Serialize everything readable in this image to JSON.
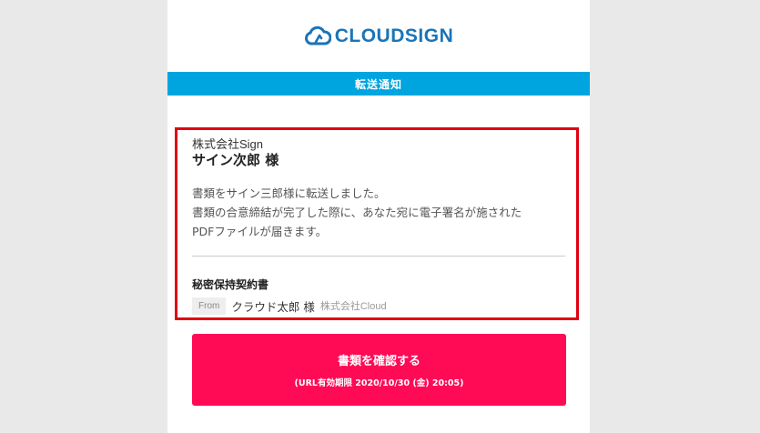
{
  "brand": {
    "logo_part1": "CLOUD",
    "logo_part2": "SIGN",
    "icon": "cloud-sign-icon",
    "color": "#1b74b8"
  },
  "banner": {
    "text": "転送通知",
    "color": "#00a5e0"
  },
  "recipient": {
    "company": "株式会社Sign",
    "name": "サイン次郎 様"
  },
  "message": {
    "line1": "書類をサイン三郎様に転送しました。",
    "line2": "書類の合意締結が完了した際に、あなた宛に電子署名が施された",
    "line3": "PDFファイルが届きます。"
  },
  "document": {
    "title": "秘密保持契約書",
    "from_label": "From",
    "sender_name": "クラウド太郎 様",
    "sender_company": "株式会社Cloud"
  },
  "cta": {
    "label": "書類を確認する",
    "sublabel": "(URL有効期限 2020/10/30 (金) 20:05)",
    "color": "#ff0a55"
  },
  "highlight_color": "#e00010"
}
